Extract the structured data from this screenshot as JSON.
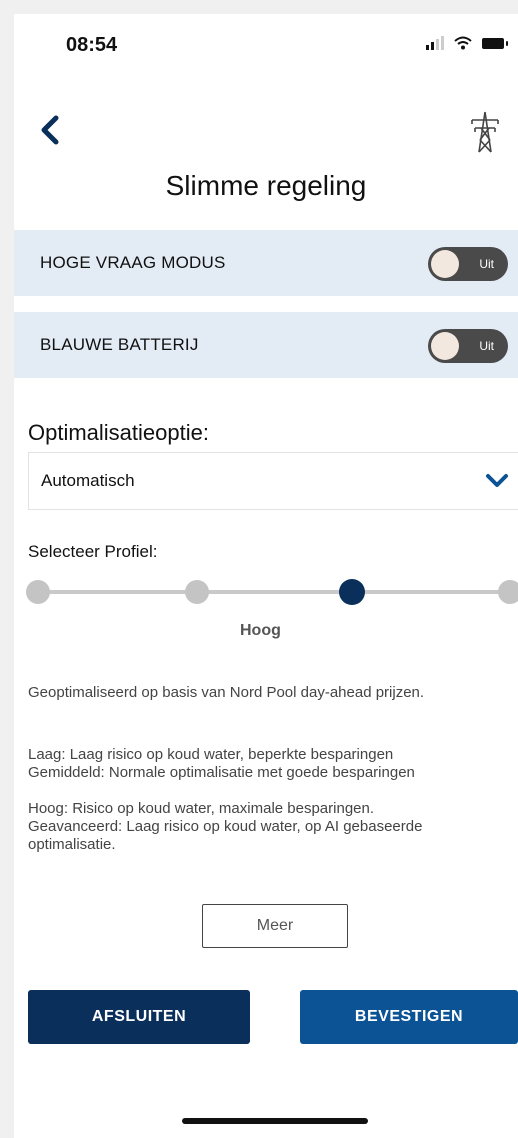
{
  "status_bar": {
    "time": "08:54"
  },
  "header": {
    "title": "Slimme regeling",
    "back_icon": "chevron-left-icon",
    "tower_icon": "power-tower-icon"
  },
  "toggles": [
    {
      "label": "HOGE VRAAG MODUS",
      "state": "Uit"
    },
    {
      "label": "BLAUWE BATTERIJ",
      "state": "Uit"
    }
  ],
  "optimization": {
    "heading": "Optimalisatieoptie:",
    "selected": "Automatisch"
  },
  "profile": {
    "heading": "Selecteer Profiel:",
    "selected_label": "Hoog",
    "selected_index": 2,
    "step_count": 4
  },
  "description": {
    "intro": "Geoptimaliseerd op basis van Nord Pool day-ahead prijzen.",
    "lines": [
      "Laag: Laag risico op koud water, beperkte besparingen",
      "Gemiddeld: Normale optimalisatie met goede besparingen",
      "Hoog: Risico op koud water, maximale besparingen.",
      "Geavanceerd: Laag risico op koud water, op AI gebaseerde optimalisatie."
    ]
  },
  "more_button": "Meer",
  "actions": {
    "close": "AFSLUITEN",
    "confirm": "BEVESTIGEN"
  },
  "colors": {
    "navy": "#0a2f5a",
    "blue": "#0b5395",
    "toggle_row_bg": "#e3ebf5"
  }
}
